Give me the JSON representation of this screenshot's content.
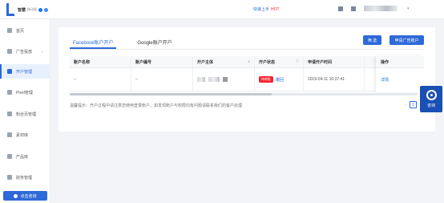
{
  "topbar": {
    "brand": "智慧",
    "brand_sub": "移动版",
    "promo_text": "快速上手",
    "promo_badge": "HOT",
    "colors": {
      "accent": "#2d6ad8",
      "hot": "#f5222d"
    }
  },
  "sidebar": {
    "items": [
      {
        "label": "首页",
        "icon": "home-icon"
      },
      {
        "label": "广告投放",
        "icon": "target-icon"
      },
      {
        "label": "开户管理",
        "icon": "account-icon",
        "active": true
      },
      {
        "label": "Pixel管理",
        "icon": "pixel-icon"
      },
      {
        "label": "粉丝页管理",
        "icon": "heart-icon"
      },
      {
        "label": "素材库",
        "icon": "image-icon"
      },
      {
        "label": "产品库",
        "icon": "product-icon"
      },
      {
        "label": "财务管理",
        "icon": "finance-icon"
      }
    ],
    "consult_label": "点击咨询"
  },
  "main": {
    "tabs": [
      {
        "label": "Facebook账户开户",
        "active": true
      },
      {
        "label": "Google账户开户",
        "active": false
      }
    ],
    "filter_button": "筛 选",
    "apply_button": "申请广告账户",
    "table": {
      "headers": [
        "账户名称",
        "账户编号",
        "开户主体",
        "开户状态",
        "申请开户时间",
        "操作"
      ],
      "rows": [
        {
          "name": "--",
          "id": "--",
          "entity": "",
          "status_badge": "待审批",
          "status_link": "撤回",
          "time": "2019-04-11 10:37:41",
          "action": "详情"
        }
      ]
    },
    "tip": "温馨提示：开户过程中请注意您使用登录账户，如发现账户与权限均有问题请联系我们的客户处理",
    "pagination": {
      "current": "1"
    }
  },
  "float_help": {
    "label": "咨询"
  }
}
